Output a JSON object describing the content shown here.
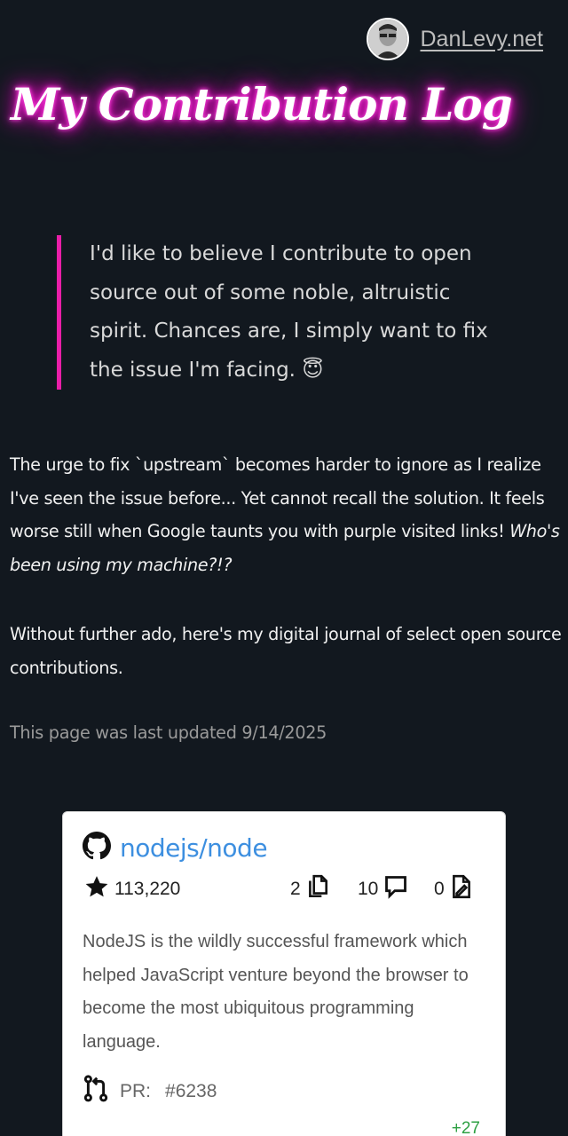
{
  "header": {
    "site_link": "DanLevy.net"
  },
  "title": "My Contribution Log",
  "quote": {
    "text": "I'd like to believe I contribute to open source out of some noble, altruistic spirit. Chances are, I simply want to fix the issue I'm facing.",
    "emoji": "😇"
  },
  "intro": {
    "para1_text": "The urge to fix `upstream` becomes harder to ignore as I realize I've seen the issue before... Yet cannot recall the solution. It feels worse still when Google taunts you with purple visited links!",
    "para1_emphasis": "Who's been using my machine?!?",
    "para2_text": "Without further ado, here's my digital journal of select open source contributions."
  },
  "last_updated": "This page was last updated 9/14/2025",
  "card": {
    "repo": "nodejs/node",
    "stars": "113,220",
    "files": "2",
    "comments": "10",
    "edits": "0",
    "description": "NodeJS is the wildly successful framework which helped JavaScript venture beyond the browser to become the most ubiquitous programming language.",
    "pr_label": "PR:",
    "pr_number": "#6238",
    "additions": "+27"
  },
  "colors": {
    "background": "#12181f",
    "neon_pink": "#ff1fd6",
    "quote_border": "#e91ea8",
    "link_blue": "#3d8fe0",
    "additions_green": "#2ea043"
  },
  "icons": [
    "github-icon",
    "star-icon",
    "files-icon",
    "comment-icon",
    "file-edit-icon",
    "pull-request-icon"
  ]
}
